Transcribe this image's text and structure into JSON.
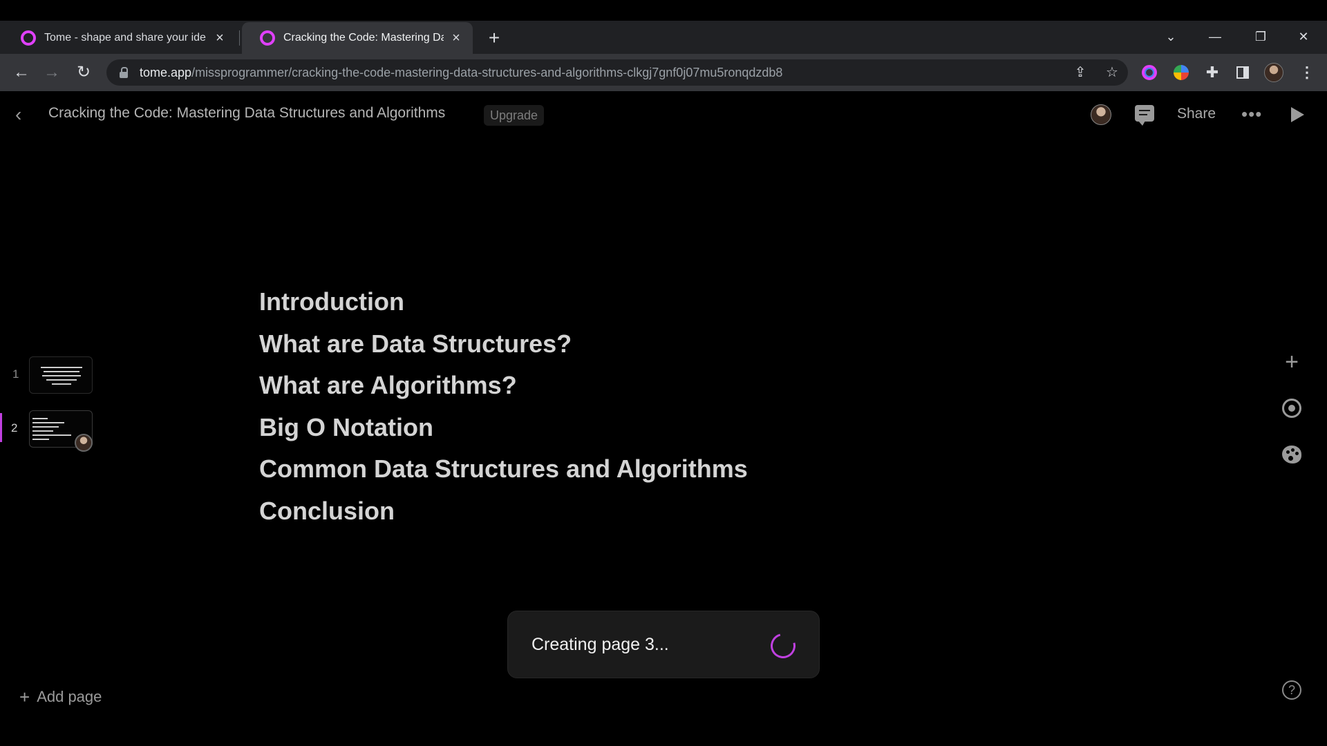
{
  "browser": {
    "tabs": [
      {
        "title": "Tome - shape and share your ide",
        "active": false
      },
      {
        "title": "Cracking the Code: Mastering Da",
        "active": true
      }
    ],
    "url_host": "tome.app",
    "url_path": "/missprogrammer/cracking-the-code-mastering-data-structures-and-algorithms-clkgj7gnf0j07mu5ronqdzdb8"
  },
  "header": {
    "title": "Cracking the Code: Mastering Data Structures and Algorithms",
    "upgrade_label": "Upgrade",
    "share_label": "Share"
  },
  "thumbnails": [
    {
      "number": "1"
    },
    {
      "number": "2"
    }
  ],
  "agenda": {
    "items": [
      "Introduction",
      "What are Data Structures?",
      "What are Algorithms?",
      "Big O Notation",
      "Common Data Structures and Algorithms",
      "Conclusion"
    ]
  },
  "toast": {
    "message": "Creating page 3..."
  },
  "footer": {
    "add_page_label": "Add page"
  },
  "colors": {
    "accent": "#c040e0",
    "background": "#000000",
    "text": "#d4d4d4"
  }
}
